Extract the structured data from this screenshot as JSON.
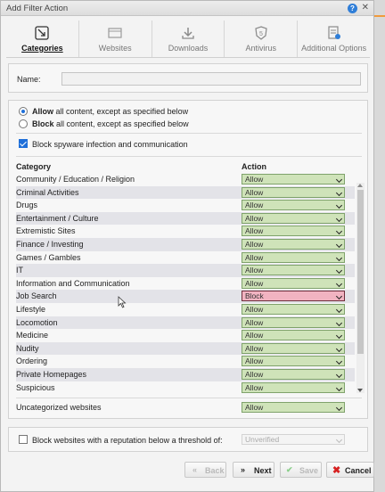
{
  "window": {
    "title": "Add Filter Action"
  },
  "tabs": [
    {
      "label": "Categories",
      "icon": "categories-icon",
      "active": true
    },
    {
      "label": "Websites",
      "icon": "websites-icon",
      "active": false
    },
    {
      "label": "Downloads",
      "icon": "downloads-icon",
      "active": false
    },
    {
      "label": "Antivirus",
      "icon": "antivirus-icon",
      "active": false
    },
    {
      "label": "Additional Options",
      "icon": "additional-options-icon",
      "active": false
    }
  ],
  "name_field": {
    "label": "Name:",
    "value": ""
  },
  "mode": {
    "allow": {
      "bold": "Allow",
      "rest": "all content, except as specified below",
      "selected": true
    },
    "block": {
      "bold": "Block",
      "rest": "all content, except as specified below",
      "selected": false
    }
  },
  "spyware": {
    "label": "Block spyware infection and communication",
    "checked": true
  },
  "table": {
    "col_category": "Category",
    "col_action": "Action",
    "rows": [
      {
        "category": "Community / Education / Religion",
        "action": "Allow"
      },
      {
        "category": "Criminal Activities",
        "action": "Allow"
      },
      {
        "category": "Drugs",
        "action": "Allow"
      },
      {
        "category": "Entertainment / Culture",
        "action": "Allow"
      },
      {
        "category": "Extremistic Sites",
        "action": "Allow"
      },
      {
        "category": "Finance / Investing",
        "action": "Allow"
      },
      {
        "category": "Games / Gambles",
        "action": "Allow"
      },
      {
        "category": "IT",
        "action": "Allow"
      },
      {
        "category": "Information and Communication",
        "action": "Allow"
      },
      {
        "category": "Job Search",
        "action": "Block"
      },
      {
        "category": "Lifestyle",
        "action": "Allow"
      },
      {
        "category": "Locomotion",
        "action": "Allow"
      },
      {
        "category": "Medicine",
        "action": "Allow"
      },
      {
        "category": "Nudity",
        "action": "Allow"
      },
      {
        "category": "Ordering",
        "action": "Allow"
      },
      {
        "category": "Private Homepages",
        "action": "Allow"
      },
      {
        "category": "Suspicious",
        "action": "Allow"
      }
    ]
  },
  "uncategorized": {
    "label": "Uncategorized websites",
    "action": "Allow"
  },
  "reputation": {
    "label": "Block websites with a reputation below a threshold of:",
    "value": "Unverified",
    "checked": false
  },
  "buttons": {
    "back": "Back",
    "next": "Next",
    "save": "Save",
    "cancel": "Cancel"
  },
  "colors": {
    "allow_bg": "#cfe3b9",
    "block_bg": "#f1b3c1",
    "accent": "#1e6fd9",
    "cancel_x": "#d62020"
  }
}
